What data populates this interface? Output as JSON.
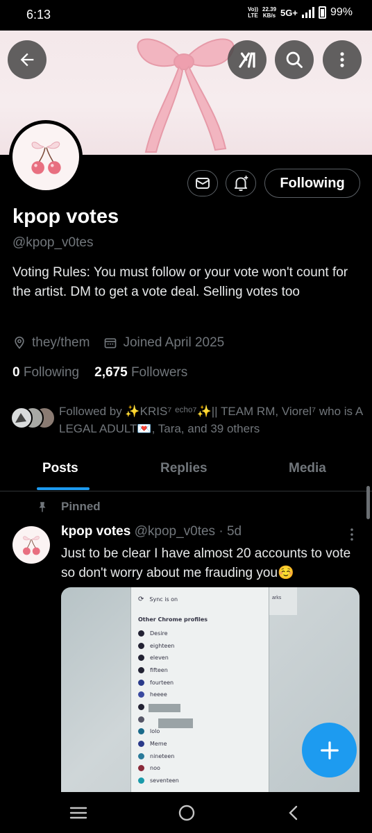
{
  "status_bar": {
    "time": "6:13",
    "net_top": "Vo))",
    "net_bottom": "LTE",
    "speed_value": "22.39",
    "speed_unit": "KB/s",
    "network": "5G+",
    "battery": "99%"
  },
  "header": {
    "back_icon": "arrow-left-icon",
    "grok_icon": "grok-icon",
    "search_icon": "search-icon",
    "more_icon": "more-vertical-icon"
  },
  "profile": {
    "display_name": "kpop votes",
    "handle": "@kpop_v0tes",
    "bio": "Voting Rules: You must follow or your vote won't count for the artist. DM to get a vote deal. Selling votes too",
    "pronouns": "they/them",
    "joined": "Joined April 2025",
    "following_count": "0",
    "following_label": "Following",
    "followers_count": "2,675",
    "followers_label": "Followers",
    "follow_button": "Following",
    "followed_by": "Followed by ✨KRIS⁷ ᵉᶜʰᵒ⁷✨|| TEAM RM, Viorel⁷ who is A LEGAL ADULT💌, Tara, and 39 others"
  },
  "tabs": [
    {
      "label": "Posts",
      "active": true
    },
    {
      "label": "Replies",
      "active": false
    },
    {
      "label": "Media",
      "active": false
    }
  ],
  "post": {
    "pinned_label": "Pinned",
    "author": "kpop votes",
    "handle": "@kpop_v0tes",
    "time": "· 5d",
    "text": "Just to be clear I have almost 20 accounts to vote so don't worry about me frauding you☺️",
    "image": {
      "sync": "Sync is on",
      "header": "Other Chrome profiles",
      "side": "arks",
      "profiles": [
        "Desire",
        "eighteen",
        "eleven",
        "fifteen",
        "fourteen",
        "heeee",
        "",
        "",
        "lolo",
        "Meme",
        "nineteen",
        "noo",
        "seventeen"
      ]
    }
  },
  "colors": {
    "accent": "#1d9bf0",
    "background": "#000000",
    "muted": "#71767b"
  }
}
